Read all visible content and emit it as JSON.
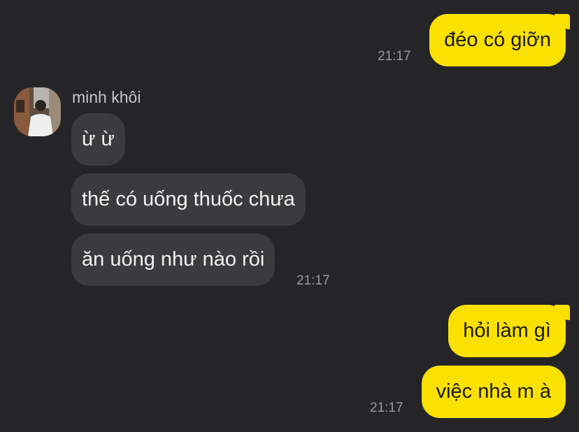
{
  "colors": {
    "background": "#252527",
    "outgoing_bubble": "#fae100",
    "incoming_bubble": "#3b3b3e",
    "timestamp": "#9a9a9e"
  },
  "chat": {
    "contact": {
      "name": "minh khôi",
      "avatar": "avatar-photo"
    },
    "messages": [
      {
        "direction": "outgoing",
        "text": "đéo có giỡn",
        "time": "21:17"
      },
      {
        "direction": "incoming",
        "text": "ừ ừ",
        "time": ""
      },
      {
        "direction": "incoming",
        "text": "thế có uống thuốc chưa",
        "time": ""
      },
      {
        "direction": "incoming",
        "text": "ăn uống như nào rồi",
        "time": "21:17"
      },
      {
        "direction": "outgoing",
        "text": "hỏi làm gì",
        "time": ""
      },
      {
        "direction": "outgoing",
        "text": "việc nhà m à",
        "time": "21:17"
      }
    ]
  }
}
